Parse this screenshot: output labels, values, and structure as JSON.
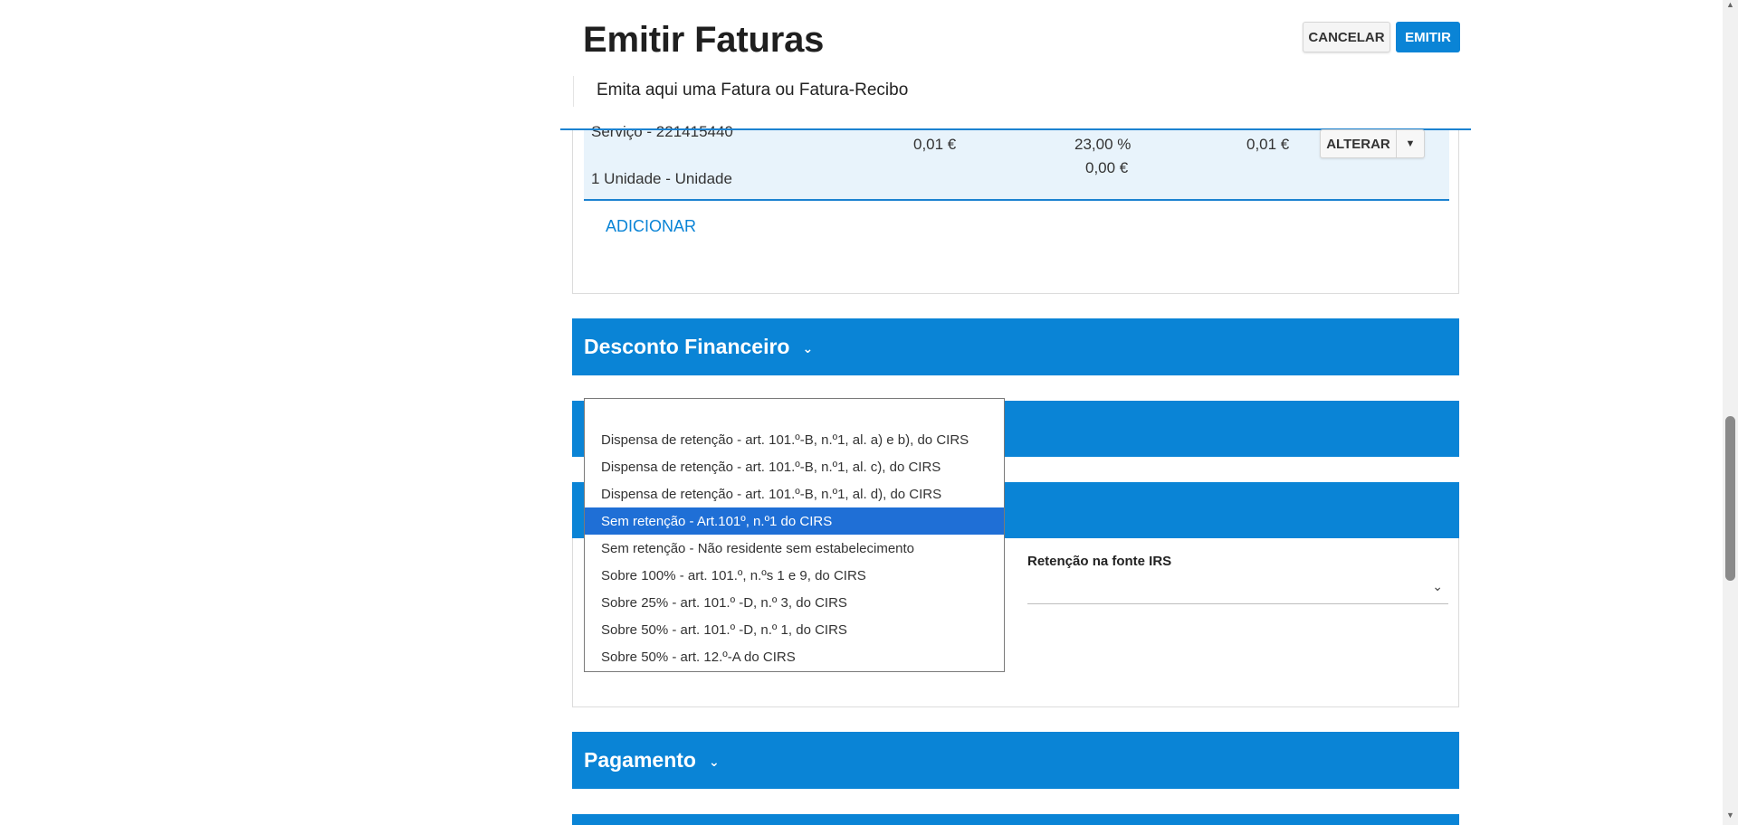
{
  "header": {
    "title": "Emitir Faturas",
    "subtitle": "Emita aqui uma Fatura ou Fatura-Recibo",
    "cancel_label": "CANCELAR",
    "emit_label": "EMITIR"
  },
  "line_item": {
    "description_partial": "Serviço - 221415440",
    "unit": "1 Unidade - Unidade",
    "price": "0,01 €",
    "tax_rate": "23,00 %",
    "tax_value": "0,00 €",
    "total": "0,01 €",
    "alter_label": "ALTERAR",
    "caret_icon": "caret-down-icon"
  },
  "add_label": "ADICIONAR",
  "sections": {
    "desconto": "Desconto Financeiro",
    "pagamento": "Pagamento",
    "chevron_icon": "chevron-down-icon"
  },
  "retention": {
    "label": "Retenção na fonte IRS",
    "selected_value": ""
  },
  "dropdown": {
    "items": [
      "",
      "Dispensa de retenção - art. 101.º-B, n.º1, al. a) e b), do CIRS",
      "Dispensa de retenção - art. 101.º-B, n.º1, al. c), do CIRS",
      "Dispensa de retenção - art. 101.º-B, n.º1, al. d), do CIRS",
      "Sem retenção - Art.101º, n.º1 do CIRS",
      "Sem retenção - Não residente sem estabelecimento",
      "Sobre 100% - art. 101.º, n.ºs 1 e 9, do CIRS",
      "Sobre 25% - art. 101.º -D, n.º 3, do CIRS",
      "Sobre 50% - art. 101.º -D, n.º 1, do CIRS",
      "Sobre 50% - art. 12.º-A do CIRS"
    ],
    "selected_index": 4
  },
  "colors": {
    "accent": "#0a84d6",
    "selected": "#1f6fd6",
    "row_highlight": "#e8f3fb"
  }
}
